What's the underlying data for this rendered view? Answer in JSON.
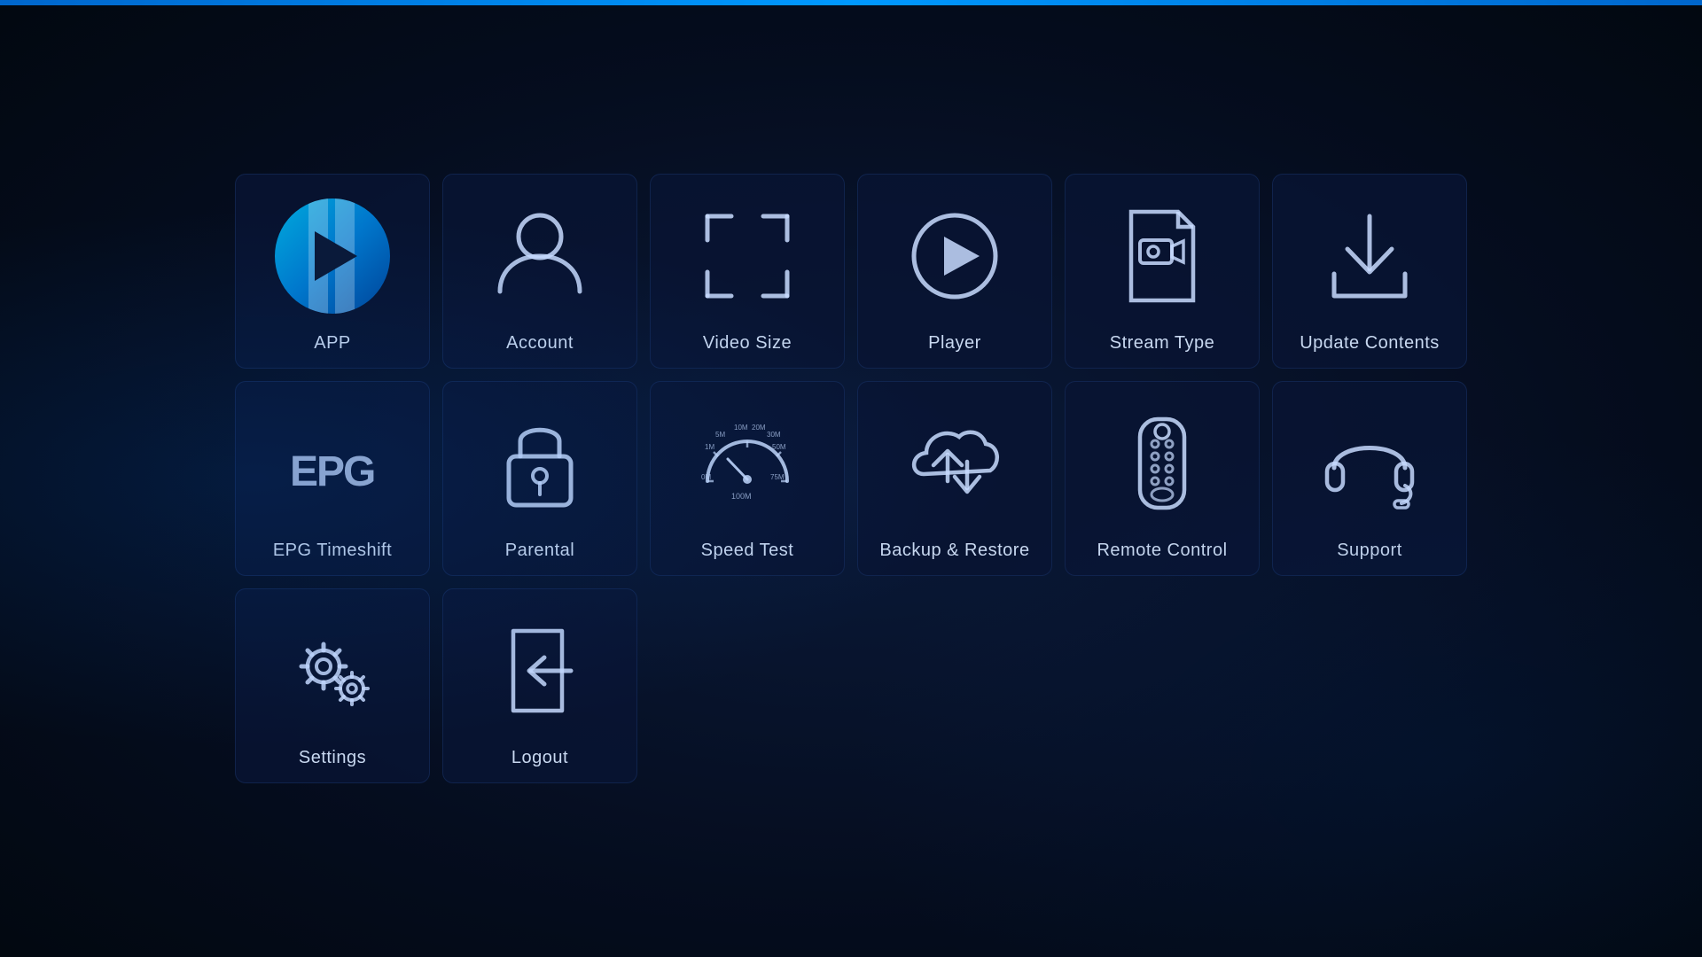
{
  "tiles": [
    {
      "id": "app",
      "label": "APP",
      "row": 1,
      "col": 1
    },
    {
      "id": "account",
      "label": "Account",
      "row": 1,
      "col": 2
    },
    {
      "id": "video-size",
      "label": "Video Size",
      "row": 1,
      "col": 3
    },
    {
      "id": "player",
      "label": "Player",
      "row": 1,
      "col": 4
    },
    {
      "id": "stream-type",
      "label": "Stream Type",
      "row": 1,
      "col": 5
    },
    {
      "id": "update-contents",
      "label": "Update Contents",
      "row": 1,
      "col": 6
    },
    {
      "id": "epg-timeshift",
      "label": "EPG Timeshift",
      "row": 2,
      "col": 1
    },
    {
      "id": "parental",
      "label": "Parental",
      "row": 2,
      "col": 2
    },
    {
      "id": "speed-test",
      "label": "Speed Test",
      "row": 2,
      "col": 3
    },
    {
      "id": "backup-restore",
      "label": "Backup & Restore",
      "row": 2,
      "col": 4
    },
    {
      "id": "remote-control",
      "label": "Remote Control",
      "row": 2,
      "col": 5
    },
    {
      "id": "support",
      "label": "Support",
      "row": 2,
      "col": 6
    },
    {
      "id": "settings",
      "label": "Settings",
      "row": 3,
      "col": 1
    },
    {
      "id": "logout",
      "label": "Logout",
      "row": 3,
      "col": 2
    }
  ]
}
